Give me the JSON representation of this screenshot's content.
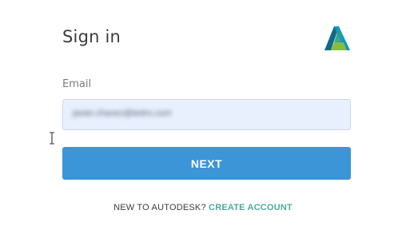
{
  "header": {
    "title": "Sign in",
    "logo_icon": "autodesk-logo-icon"
  },
  "form": {
    "email_label": "Email",
    "email_value": "javier.chavez@tedro.com",
    "next_label": "NEXT"
  },
  "footer": {
    "prompt_text": "NEW TO AUTODESK?",
    "create_account_label": "CREATE ACCOUNT"
  },
  "colors": {
    "primary_button": "#3b95d7",
    "link": "#4caa9c",
    "input_background": "#e8f0fe"
  }
}
